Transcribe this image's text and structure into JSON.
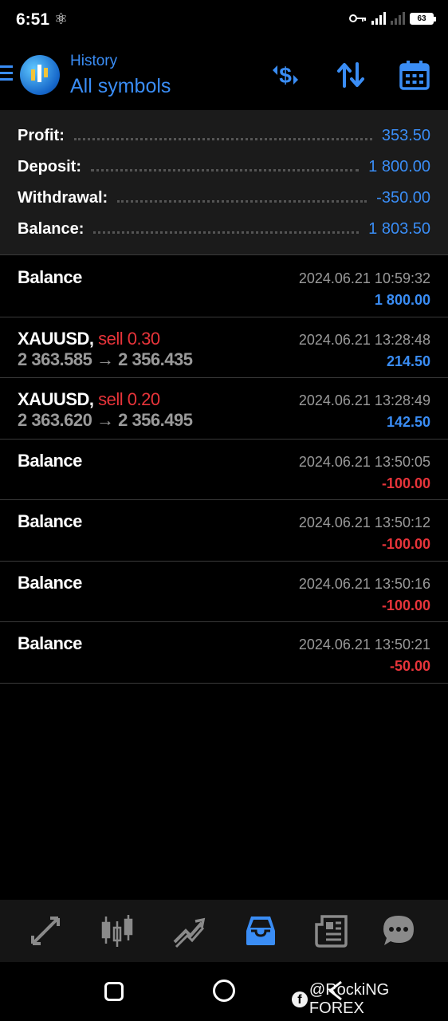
{
  "status_bar": {
    "time": "6:51",
    "battery": "63"
  },
  "header": {
    "subtitle": "History",
    "title": "All symbols"
  },
  "summary": [
    {
      "label": "Profit:",
      "value": "353.50"
    },
    {
      "label": "Deposit:",
      "value": "1 800.00"
    },
    {
      "label": "Withdrawal:",
      "value": "-350.00"
    },
    {
      "label": "Balance:",
      "value": "1 803.50"
    }
  ],
  "deals": [
    {
      "symbol": "Balance",
      "side": "",
      "prices": "",
      "time": "2024.06.21 10:59:32",
      "amount": "1 800.00",
      "negative": false
    },
    {
      "symbol": "XAUUSD,",
      "side": "sell 0.30",
      "prices": "2 363.585 → 2 356.435",
      "time": "2024.06.21 13:28:48",
      "amount": "214.50",
      "negative": false
    },
    {
      "symbol": "XAUUSD,",
      "side": "sell 0.20",
      "prices": "2 363.620 → 2 356.495",
      "time": "2024.06.21 13:28:49",
      "amount": "142.50",
      "negative": false
    },
    {
      "symbol": "Balance",
      "side": "",
      "prices": "",
      "time": "2024.06.21 13:50:05",
      "amount": "-100.00",
      "negative": true
    },
    {
      "symbol": "Balance",
      "side": "",
      "prices": "",
      "time": "2024.06.21 13:50:12",
      "amount": "-100.00",
      "negative": true
    },
    {
      "symbol": "Balance",
      "side": "",
      "prices": "",
      "time": "2024.06.21 13:50:16",
      "amount": "-100.00",
      "negative": true
    },
    {
      "symbol": "Balance",
      "side": "",
      "prices": "",
      "time": "2024.06.21 13:50:21",
      "amount": "-50.00",
      "negative": true
    }
  ],
  "bottom_nav": [
    {
      "name": "quotes",
      "icon": "arrows-icon",
      "active": false
    },
    {
      "name": "chart",
      "icon": "candlesticks-icon",
      "active": false
    },
    {
      "name": "trade",
      "icon": "trend-icon",
      "active": false
    },
    {
      "name": "history",
      "icon": "inbox-icon",
      "active": true
    },
    {
      "name": "news",
      "icon": "newspaper-icon",
      "active": false
    },
    {
      "name": "messages",
      "icon": "chat-icon",
      "active": false
    }
  ],
  "watermark": "@RockiNG FOREX",
  "colors": {
    "accent": "#3a8df5",
    "negative": "#e8343a",
    "muted": "#9a9a9a"
  }
}
